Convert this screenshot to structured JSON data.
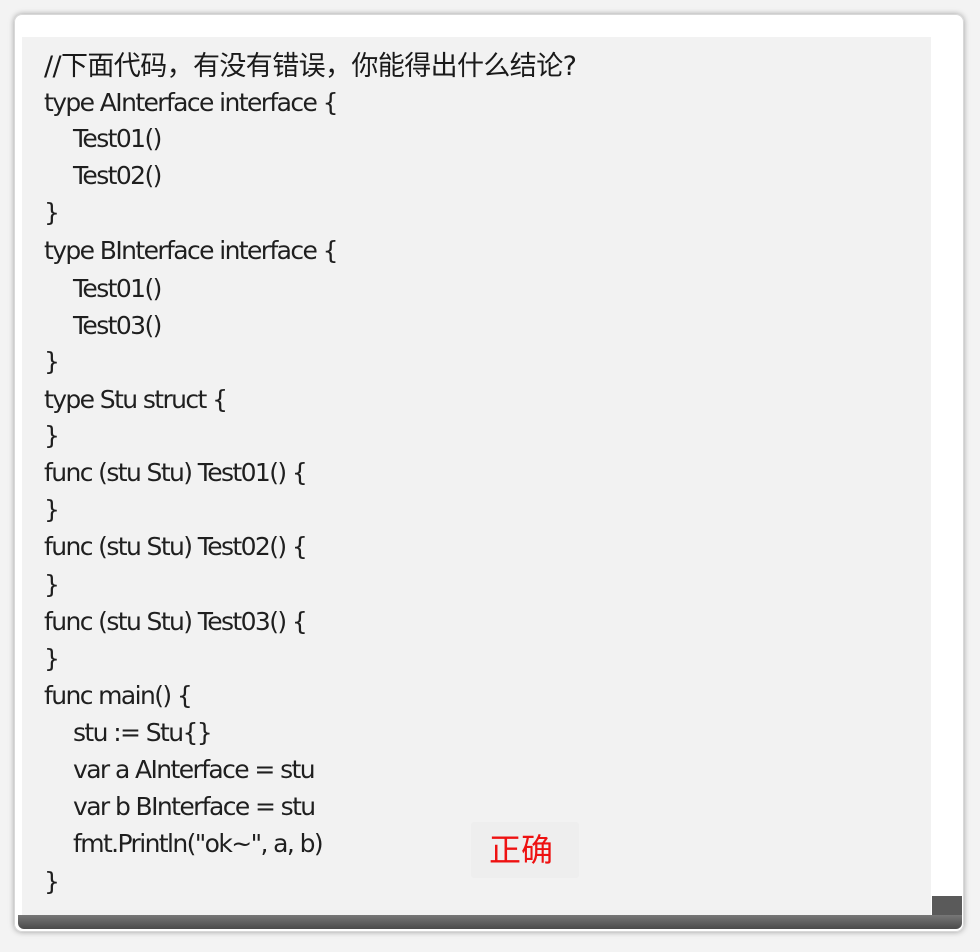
{
  "snippet": {
    "comment": "//下面代码，有没有错误，你能得出什么结论?",
    "lines": [
      "type AInterface interface {",
      "Test01()",
      "Test02()",
      "}",
      "type BInterface interface {",
      "Test01()",
      "Test03()",
      "}",
      "type Stu struct {",
      "}",
      "func (stu Stu) Test01() {",
      "}",
      "func (stu Stu) Test02() {",
      "}",
      "func (stu Stu) Test03() {",
      "}",
      "func main() {",
      "stu := Stu{}",
      "var a AInterface = stu",
      "var b BInterface = stu",
      "fmt.Println(\"ok~\", a, b)",
      "}"
    ]
  },
  "verdict": {
    "label": "正确",
    "color": "#ee1111"
  }
}
